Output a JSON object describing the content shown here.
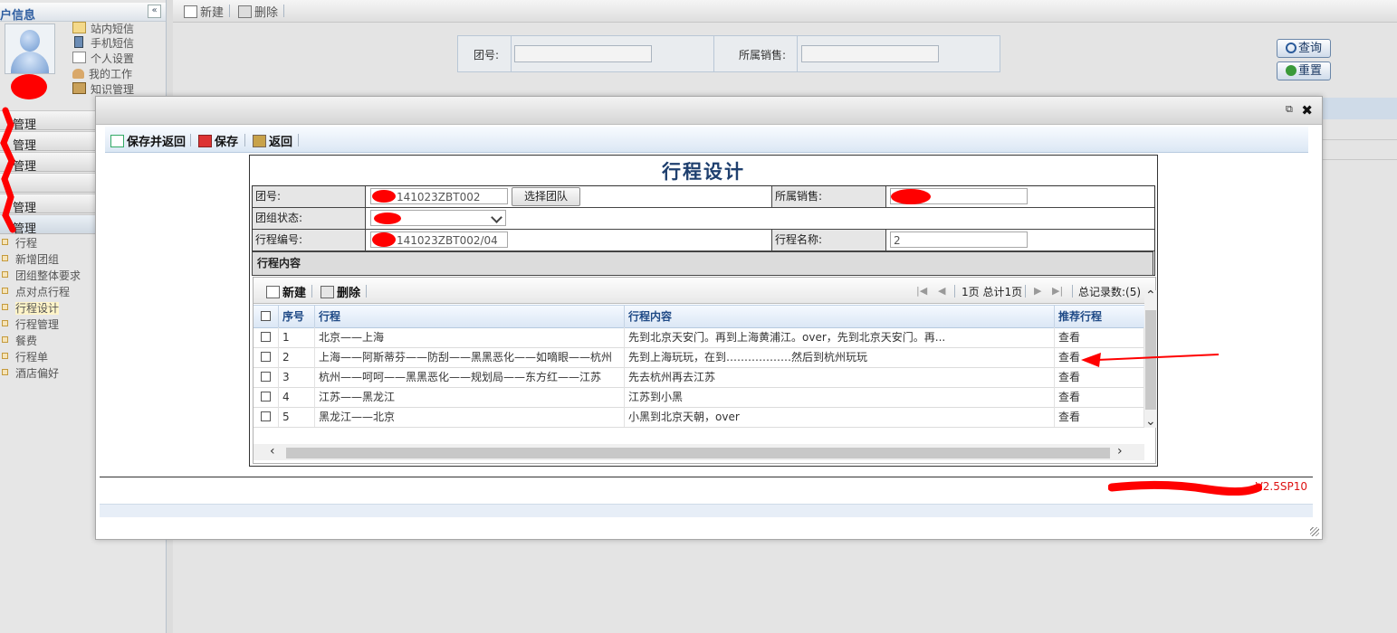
{
  "sidebar": {
    "title": "户信息",
    "collapse_glyph": "«",
    "quick_links": [
      {
        "label": "站内短信",
        "icon": "envelope-icon"
      },
      {
        "label": "手机短信",
        "icon": "mobile-phone-icon"
      },
      {
        "label": "个人设置",
        "icon": "edit-settings-icon"
      },
      {
        "label": "我的工作",
        "icon": "user-work-icon"
      },
      {
        "label": "知识管理",
        "icon": "knowledge-icon"
      }
    ],
    "menus": [
      {
        "label": "管理"
      },
      {
        "label": "管理"
      },
      {
        "label": "管理"
      },
      {
        "label": ""
      },
      {
        "label": "管理"
      },
      {
        "label": "管理"
      }
    ],
    "sub_items": [
      "行程",
      "新增团组",
      "团组整体要求",
      "点对点行程",
      "行程设计",
      "行程管理",
      "餐费",
      "行程单",
      "酒店偏好"
    ],
    "selected_sub": "行程设计"
  },
  "background": {
    "toolbar": {
      "new_label": "新建",
      "delete_label": "删除"
    },
    "search": {
      "group_label": "团号:",
      "group_value": "",
      "sales_label": "所属销售:",
      "sales_value": ""
    },
    "query_label": "查询",
    "reset_label": "重置"
  },
  "dialog": {
    "popout_glyph": "⧉",
    "close_glyph": "✖",
    "toolbar": {
      "save_return": "保存并返回",
      "save": "保存",
      "back": "返回"
    },
    "form": {
      "title": "行程设计",
      "group_no_label": "团号:",
      "group_no_value": "141023ZBT002",
      "select_team_label": "选择团队",
      "sales_label": "所属销售:",
      "sales_value": "",
      "status_label": "团组状态:",
      "status_value": "",
      "itinerary_no_label": "行程编号:",
      "itinerary_no_value": "141023ZBT002/04",
      "itinerary_name_label": "行程名称:",
      "itinerary_name_value": "2",
      "section_label": "行程内容"
    },
    "grid": {
      "new_label": "新建",
      "delete_label": "删除",
      "page_info": "1页 总计1页",
      "total_records": "总记录数:(5)",
      "columns": [
        "序号",
        "行程",
        "行程内容",
        "推荐行程"
      ],
      "rows": [
        {
          "no": "1",
          "route": "北京——上海",
          "content": "先到北京天安门。再到上海黄浦江。over，先到北京天安门。再...",
          "recommend": "查看"
        },
        {
          "no": "2",
          "route": "上海——阿斯蒂芬——防刮——黑黑恶化——如嘀眼——杭州",
          "content": "先到上海玩玩，在到………………然后到杭州玩玩",
          "recommend": "查看"
        },
        {
          "no": "3",
          "route": "杭州——呵呵——黑黑恶化——规划局——东方红——江苏",
          "content": "先去杭州再去江苏",
          "recommend": "查看"
        },
        {
          "no": "4",
          "route": "江苏——黑龙江",
          "content": "江苏到小黑",
          "recommend": "查看"
        },
        {
          "no": "5",
          "route": "黑龙江——北京",
          "content": "小黑到北京天朝，over",
          "recommend": "查看"
        }
      ]
    },
    "version": "V2.5SP10"
  },
  "colors": {
    "annotation_red": "#ff0000",
    "title_blue": "#1e3f6e",
    "header_blue": "#1f4a86"
  }
}
